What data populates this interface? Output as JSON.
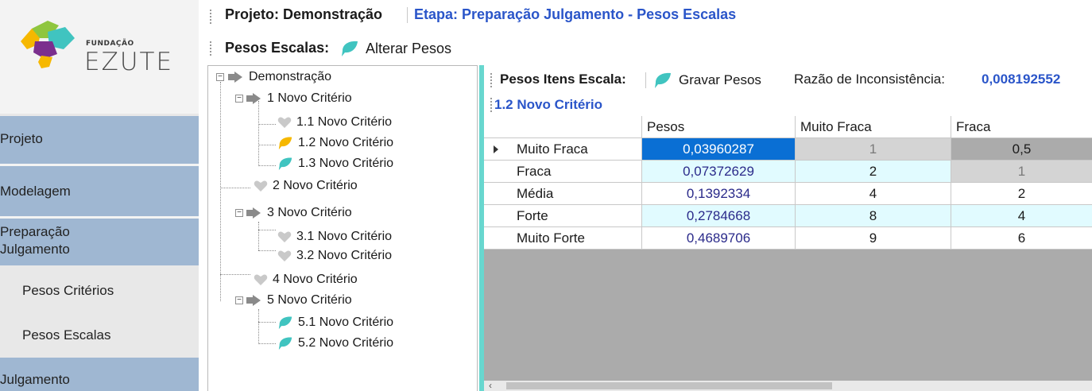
{
  "logo": {
    "small": "FUNDAÇÃO",
    "big": "EZUTE"
  },
  "sidebar": {
    "items": [
      {
        "label": "Projeto"
      },
      {
        "label": "Modelagem"
      },
      {
        "label": "Preparação\nJulgamento"
      },
      {
        "label": "Pesos Critérios"
      },
      {
        "label": "Pesos Escalas"
      },
      {
        "label": "Julgamento"
      }
    ]
  },
  "toolbar1": {
    "project_label": "Projeto: Demonstração",
    "etapa_label": "Etapa: Preparação Julgamento - Pesos Escalas"
  },
  "toolbar2": {
    "title": "Pesos Escalas:",
    "alter_button": "Alterar Pesos"
  },
  "tree": {
    "nodes": [
      {
        "label": "Demonstração",
        "icon": "arrow-icon"
      },
      {
        "label": "1 Novo Critério",
        "icon": "arrow-icon"
      },
      {
        "label": "1.1 Novo Critério",
        "icon": "heart-icon"
      },
      {
        "label": "1.2 Novo Critério",
        "icon": "yellow-leaf-icon"
      },
      {
        "label": "1.3 Novo Critério",
        "icon": "teal-leaf-icon"
      },
      {
        "label": "2 Novo Critério",
        "icon": "heart-icon"
      },
      {
        "label": "3 Novo Critério",
        "icon": "arrow-icon"
      },
      {
        "label": "3.1 Novo Critério",
        "icon": "heart-icon"
      },
      {
        "label": "3.2 Novo Critério",
        "icon": "heart-icon"
      },
      {
        "label": "4 Novo Critério",
        "icon": "heart-icon"
      },
      {
        "label": "5 Novo Critério",
        "icon": "arrow-icon"
      },
      {
        "label": "5.1 Novo Critério",
        "icon": "teal-leaf-icon"
      },
      {
        "label": "5.2 Novo Critério",
        "icon": "teal-leaf-icon"
      }
    ],
    "expander_symbol": "−"
  },
  "panel": {
    "toolbar_title": "Pesos Itens Escala:",
    "save_button": "Gravar Pesos",
    "ratio_label": "Razão de Inconsistência:",
    "ratio_value": "0,008192552",
    "subtitle": "1.2 Novo Critério"
  },
  "grid": {
    "columns": [
      "",
      "Pesos",
      "Muito Fraca",
      "Fraca"
    ],
    "rows": [
      {
        "label": "Muito Fraca",
        "values": [
          "0,03960287",
          "1",
          "0,5"
        ]
      },
      {
        "label": "Fraca",
        "values": [
          "0,07372629",
          "2",
          "1"
        ]
      },
      {
        "label": "Média",
        "values": [
          "0,1392334",
          "4",
          "2"
        ]
      },
      {
        "label": "Forte",
        "values": [
          "0,2784668",
          "8",
          "4"
        ]
      },
      {
        "label": "Muito Forte",
        "values": [
          "0,4689706",
          "9",
          "6"
        ]
      }
    ],
    "scroll_left": "‹"
  },
  "colors": {
    "accent_blue": "#2a55c9",
    "sidebar_active": "#9fb7d2",
    "selection": "#0a6fd4",
    "teal": "#40c4c0",
    "yellow": "#f6b800"
  }
}
